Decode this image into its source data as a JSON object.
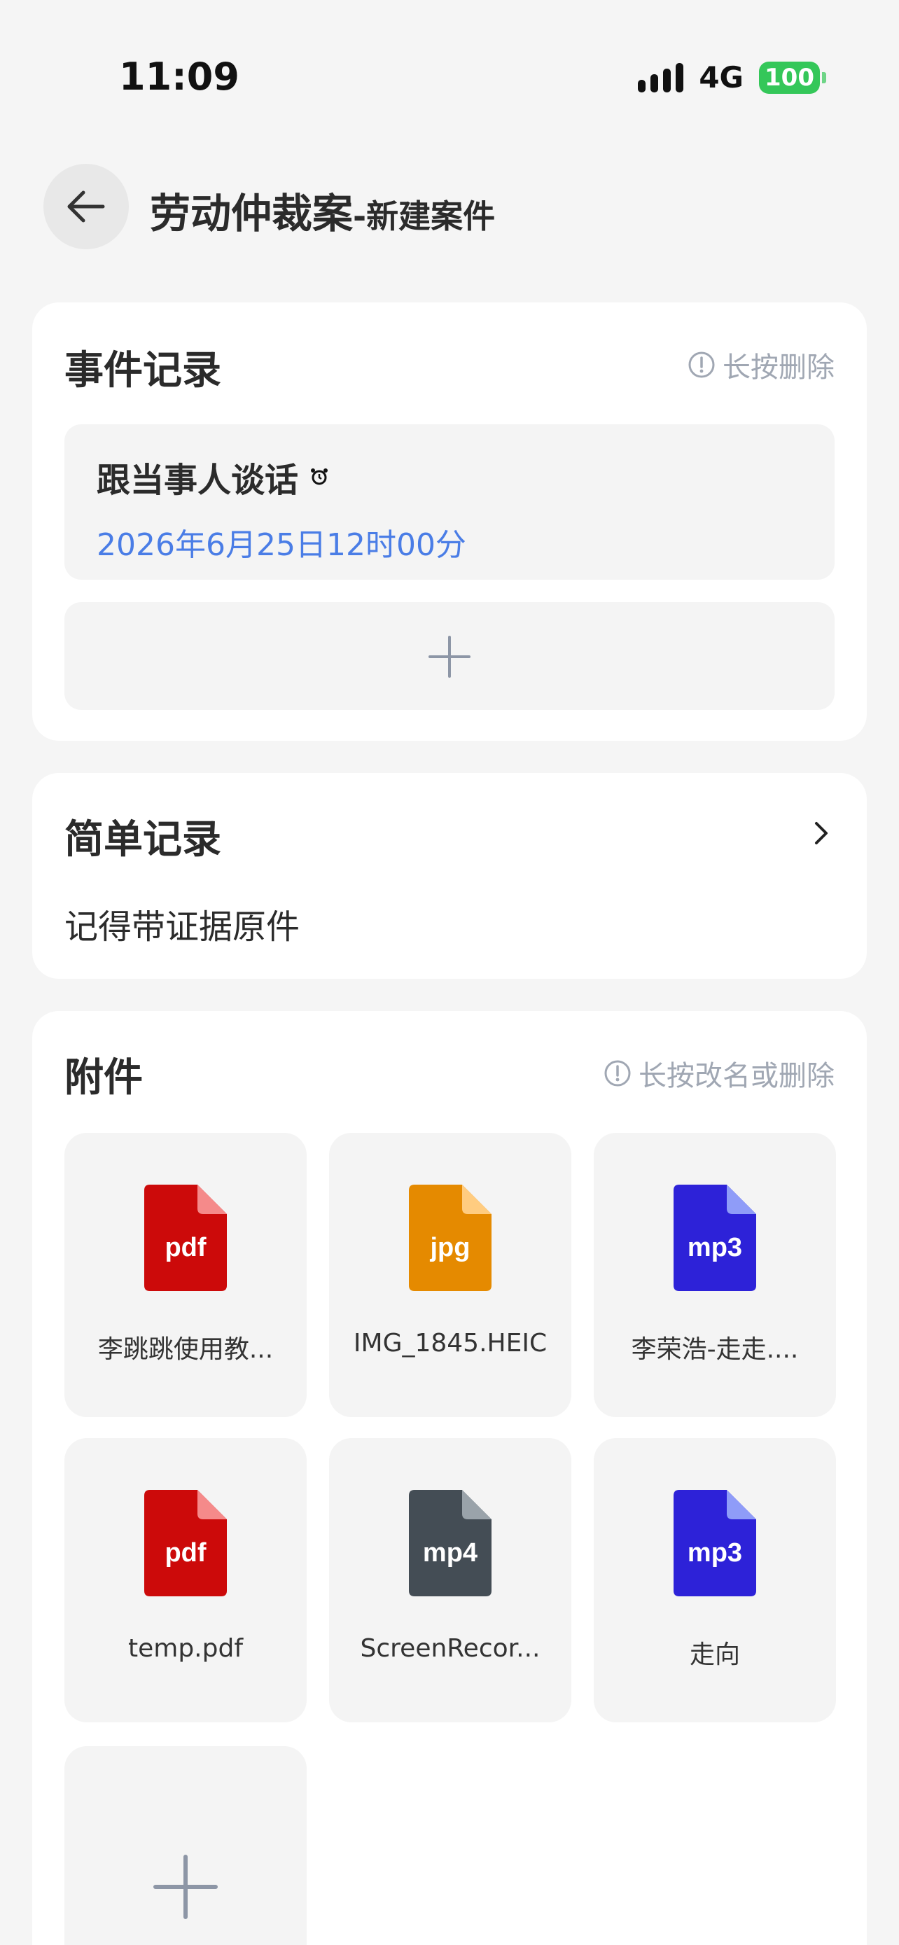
{
  "status": {
    "time": "11:09",
    "network": "4G",
    "battery": "100"
  },
  "header": {
    "title_main": "劳动仲裁案",
    "title_sub": "-新建案件"
  },
  "events": {
    "title": "事件记录",
    "hint": "长按删除",
    "items": [
      {
        "name": "跟当事人谈话",
        "date": "2026年6月25日12时00分",
        "icon": "alarm-clock-icon"
      }
    ]
  },
  "notes": {
    "title": "简单记录",
    "content": "记得带证据原件"
  },
  "attachments": {
    "title": "附件",
    "hint": "长按改名或删除",
    "files": [
      {
        "ext": "pdf",
        "name": "李跳跳使用教...",
        "color": "#cc0a0a",
        "fold": "#f58a8a"
      },
      {
        "ext": "jpg",
        "name": "IMG_1845.HEIC",
        "color": "#e58a00",
        "fold": "#ffcc80"
      },
      {
        "ext": "mp3",
        "name": "李荣浩-走走....",
        "color": "#2d22d8",
        "fold": "#8f9cf8"
      },
      {
        "ext": "pdf",
        "name": "temp.pdf",
        "color": "#cc0a0a",
        "fold": "#f58a8a"
      },
      {
        "ext": "mp4",
        "name": "ScreenRecor...",
        "color": "#444d55",
        "fold": "#9aa3aa"
      },
      {
        "ext": "mp3",
        "name": "走向",
        "color": "#2d22d8",
        "fold": "#8f9cf8"
      }
    ]
  },
  "colors": {
    "accent": "#4a7de6",
    "hint": "#a0a7b3",
    "background": "#f5f5f5"
  }
}
